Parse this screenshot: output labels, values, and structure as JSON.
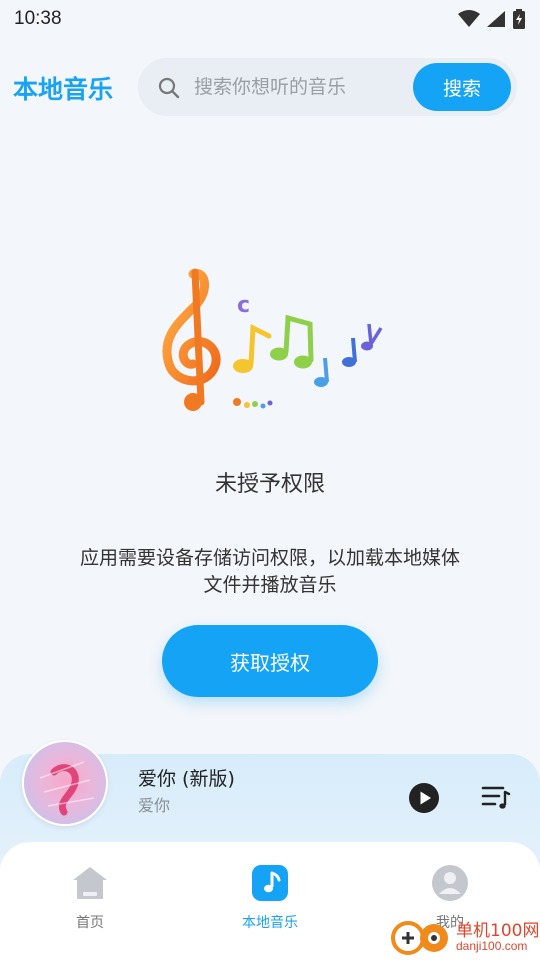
{
  "status_bar": {
    "time": "10:38",
    "icons": [
      "wifi-icon",
      "signal-icon",
      "battery-charging-icon"
    ]
  },
  "header": {
    "title": "本地音乐",
    "search_placeholder": "搜索你想听的音乐",
    "search_button": "搜索"
  },
  "permission": {
    "title": "未授予权限",
    "description": "应用需要设备存储访问权限，以加载本地媒体文件并播放音乐",
    "grant_button": "获取授权"
  },
  "player": {
    "song_title": "爱你 (新版)",
    "artist": "爱你",
    "icons": [
      "play-icon",
      "playlist-icon"
    ]
  },
  "bottom_nav": {
    "items": [
      {
        "label": "首页",
        "icon": "home-icon",
        "active": false
      },
      {
        "label": "本地音乐",
        "icon": "music-note-icon",
        "active": true
      },
      {
        "label": "我的",
        "icon": "user-icon",
        "active": false
      }
    ]
  },
  "watermark": {
    "name": "单机100网",
    "url": "danji100.com"
  },
  "colors": {
    "accent": "#15a4f5",
    "background": "#f3f6fa",
    "player_bg": "#d7ecfb"
  }
}
